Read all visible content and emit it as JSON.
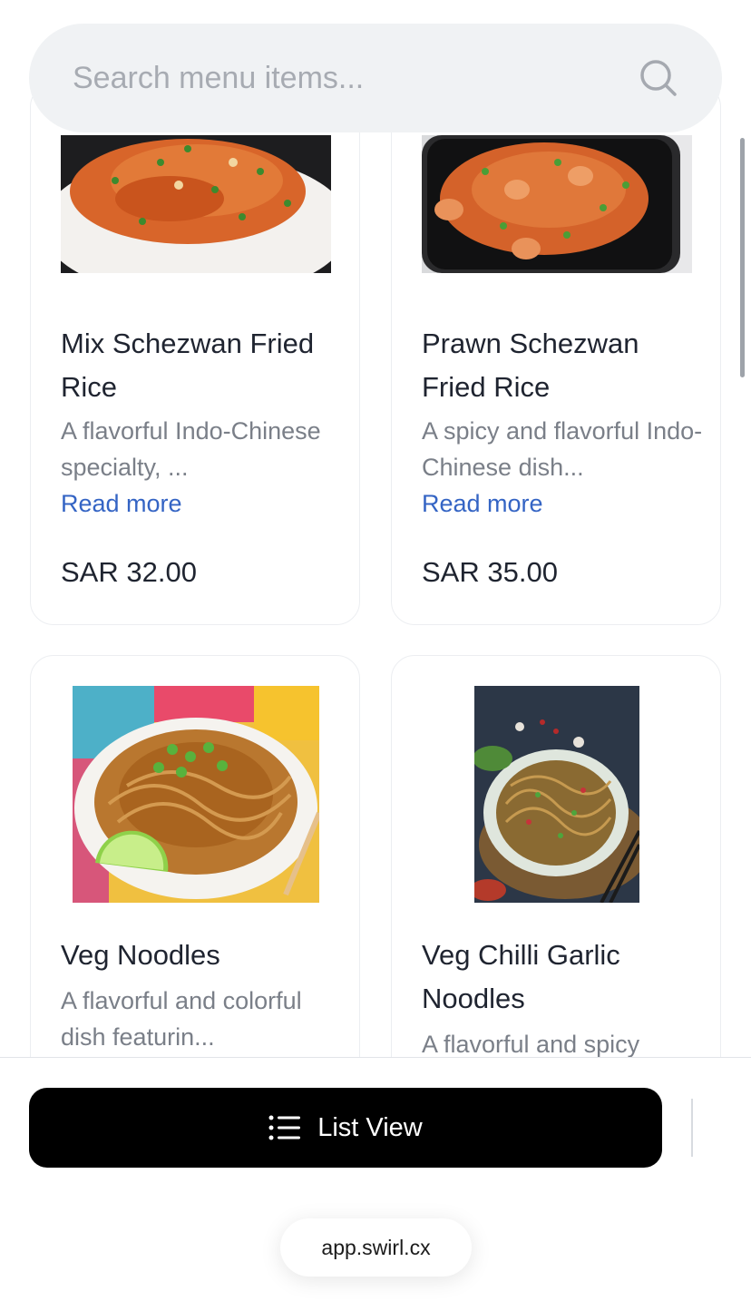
{
  "search": {
    "placeholder": "Search menu items..."
  },
  "menu": {
    "items": [
      {
        "name": "Mix Schezwan Fried Rice",
        "description": "A flavorful Indo-Chinese specialty, ...",
        "read_more": "Read more",
        "price": "SAR 32.00",
        "image": "fried-rice-image"
      },
      {
        "name": "Prawn Schezwan Fried Rice",
        "description": "A spicy and flavorful Indo-Chinese dish...",
        "read_more": "Read more",
        "price": "SAR 35.00",
        "image": "prawn-fried-rice-image"
      },
      {
        "name": "Veg Noodles",
        "description": "A flavorful and colorful dish featurin...",
        "image": "noodles-image"
      },
      {
        "name": "Veg Chilli Garlic Noodles",
        "description": "A flavorful and spicy",
        "image": "chilli-garlic-noodles-image"
      }
    ]
  },
  "bottom_bar": {
    "list_view_label": "List View",
    "list_icon": "list-icon",
    "url": "app.swirl.cx"
  },
  "colors": {
    "accent_link": "#3464c4",
    "button_bg": "#000000",
    "search_bg": "#f0f2f4"
  }
}
